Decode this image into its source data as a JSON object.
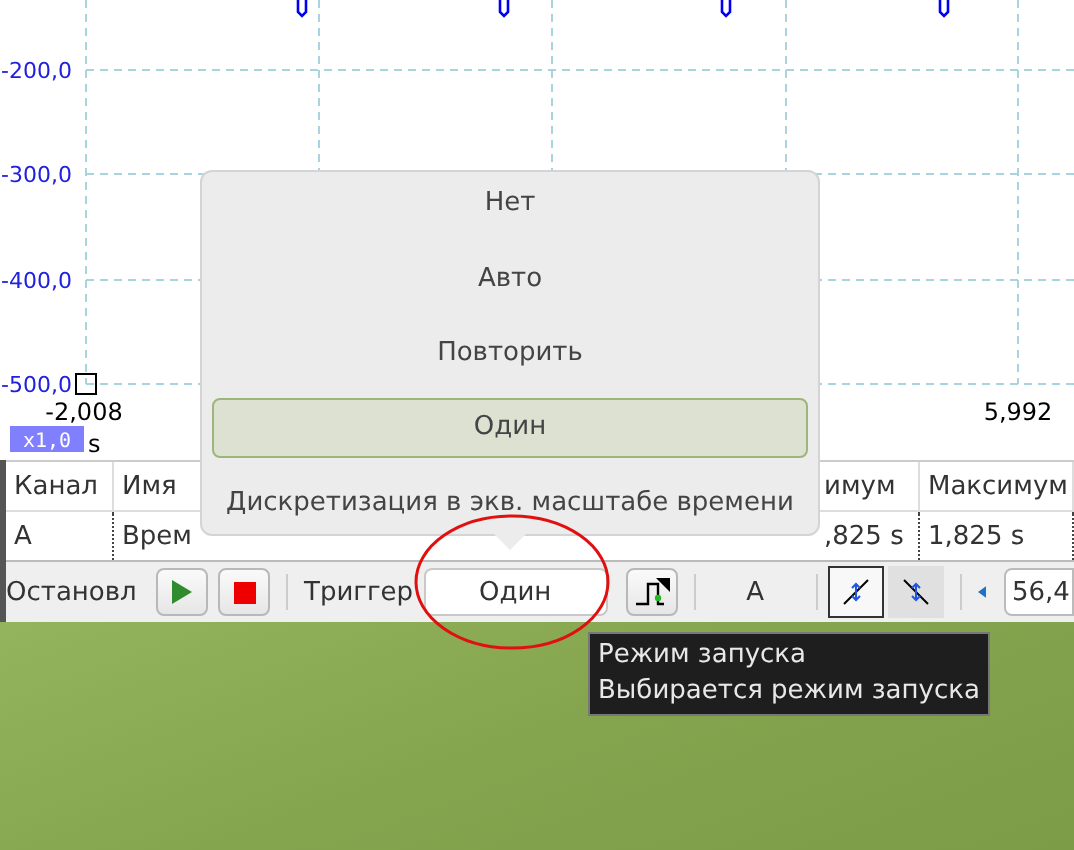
{
  "plot": {
    "y_axis_labels": [
      "-200,0",
      "-300,0",
      "-400,0",
      "-500,0"
    ],
    "x_axis_labels": [
      "-2,008",
      "5,992"
    ],
    "zoom_badge": "x1,0",
    "unit": "s"
  },
  "table": {
    "columns": [
      "Канал",
      "Имя",
      "имум",
      "Максимум"
    ],
    "rows": [
      [
        "А",
        "Врем",
        ",825 s",
        "1,825 s"
      ]
    ]
  },
  "toolbar": {
    "status": "Остановл",
    "trigger_label": "Триггер",
    "trigger_mode": "Один",
    "channel": "A",
    "edges": [
      {
        "kind": "rising",
        "selected": true
      },
      {
        "kind": "falling",
        "selected": false
      }
    ],
    "threshold": "56,4"
  },
  "menu": {
    "items": [
      {
        "label": "Нет",
        "selected": false
      },
      {
        "label": "Авто",
        "selected": false
      },
      {
        "label": "Повторить",
        "selected": false
      },
      {
        "label": "Один",
        "selected": true
      },
      {
        "label": "Дискретизация в экв. масштабе времени",
        "selected": false
      }
    ]
  },
  "tooltip": {
    "title": "Режим запуска",
    "text": "Выбирается режим запуска"
  }
}
